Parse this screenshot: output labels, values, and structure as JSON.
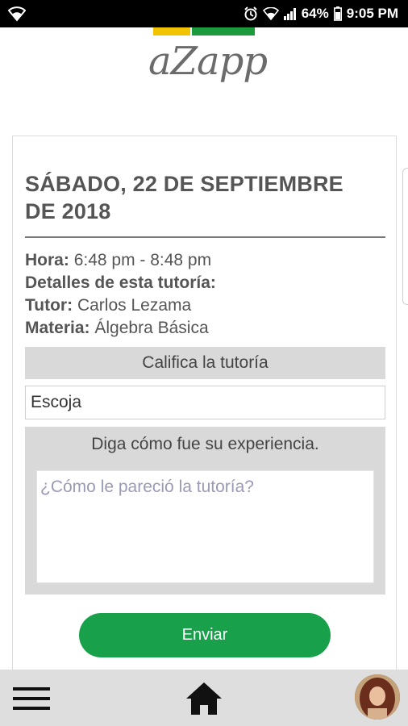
{
  "status_bar": {
    "battery": "64%",
    "time": "9:05 PM",
    "icons": [
      "wifi-icon",
      "alarm-icon",
      "wifi-icon",
      "signal-icon",
      "battery-icon"
    ]
  },
  "app": {
    "logo_text": "aZapp",
    "brand_colors": {
      "yellow": "#f2c400",
      "green": "#1c9a3e"
    }
  },
  "session": {
    "date_title": "SÁBADO, 22 DE SEPTIEMBRE DE 2018",
    "hora_label": "Hora:",
    "hora_value": "6:48 pm - 8:48 pm",
    "details_label": "Detalles de esta tutoría:",
    "tutor_label": "Tutor:",
    "tutor_value": "Carlos Lezama",
    "materia_label": "Materia:",
    "materia_value": "Álgebra Básica"
  },
  "rating": {
    "header": "Califica la tutoría",
    "select_value": "Escoja"
  },
  "experience": {
    "label": "Diga cómo fue su experiencia.",
    "placeholder": "¿Cómo le pareció la tutoría?"
  },
  "actions": {
    "submit_label": "Enviar",
    "submit_color": "#18a14a"
  },
  "bottom_nav": {
    "icons": [
      "menu-icon",
      "home-icon",
      "avatar"
    ]
  }
}
